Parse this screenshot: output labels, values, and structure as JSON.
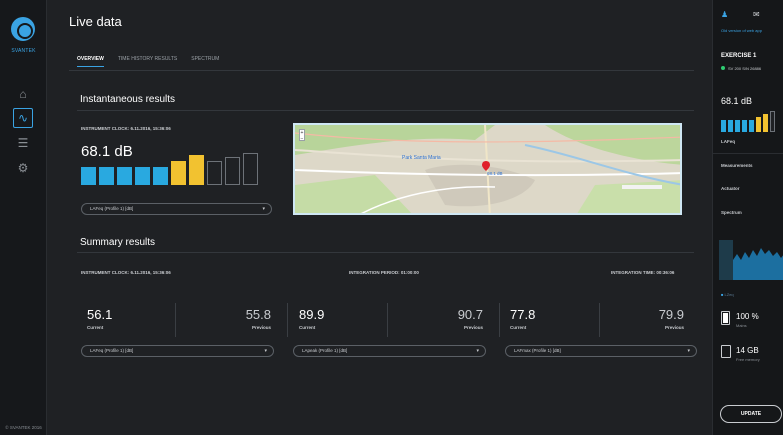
{
  "app": {
    "brand": "SVANTEK",
    "copyright": "© SVANTEK 2016"
  },
  "nav": {
    "items": [
      {
        "name": "home-icon",
        "glyph": "⌂",
        "active": false
      },
      {
        "name": "live-data-icon",
        "glyph": "∿",
        "active": true
      },
      {
        "name": "list-icon",
        "glyph": "☰",
        "active": false
      },
      {
        "name": "settings-icon",
        "glyph": "⚙",
        "active": false
      }
    ]
  },
  "page": {
    "title": "Live data",
    "tabs": [
      {
        "label": "OVERVIEW",
        "active": true
      },
      {
        "label": "TIME HISTORY RESULTS",
        "active": false
      },
      {
        "label": "SPECTRUM",
        "active": false
      }
    ]
  },
  "instantaneous": {
    "title": "Instantaneous results",
    "clock_label": "INSTRUMENT CLOCK: 6.11.2016, 15:36:06",
    "value": "68.1 dB",
    "level_bars_filled": 7,
    "level_bars_total": 10,
    "level_colors": [
      "#29a9e0",
      "#29a9e0",
      "#29a9e0",
      "#29a9e0",
      "#29a9e0",
      "#f2c230",
      "#f2c230"
    ],
    "dropdown": "LAFeq (Profile 1) [dB]",
    "map": {
      "marker_label": "68.1 dB",
      "place_label": "Park Santa Maria",
      "zoom_in": "+",
      "zoom_out": "−"
    }
  },
  "summary": {
    "title": "Summary results",
    "clock_label": "INSTRUMENT CLOCK: 6.11.2016, 15:36:06",
    "integration_period": "INTEGRATION PERIOD: 01:00:00",
    "integration_time": "INTEGRATION TIME: 00:36:06",
    "metrics": [
      {
        "current": "56.1",
        "current_label": "Current",
        "previous": "55.8",
        "previous_label": "Previous",
        "dropdown": "LAFeq (Profile 1) [dB]"
      },
      {
        "current": "89.9",
        "current_label": "Current",
        "previous": "90.7",
        "previous_label": "Previous",
        "dropdown": "LApeak (Profile 1) [dB]"
      },
      {
        "current": "77.8",
        "current_label": "Current",
        "previous": "79.9",
        "previous_label": "Previous",
        "dropdown": "LAFmax (Profile 1) [dB]"
      }
    ]
  },
  "right": {
    "link": "Old version of web app",
    "exercise": "EXERCISE 1",
    "status": "SV 200 S/N 26886",
    "value": "68.1 dB",
    "unit": "LAFeq",
    "menu": [
      "Measurements",
      "Actuator",
      "Spectrum"
    ],
    "battery_value": "100 %",
    "battery_label": "Mains",
    "memory_value": "14 GB",
    "memory_label": "Free memory",
    "update_label": "UPDATE",
    "colors": {
      "accent": "#3aa3e3",
      "ok": "#2ecc71"
    }
  }
}
